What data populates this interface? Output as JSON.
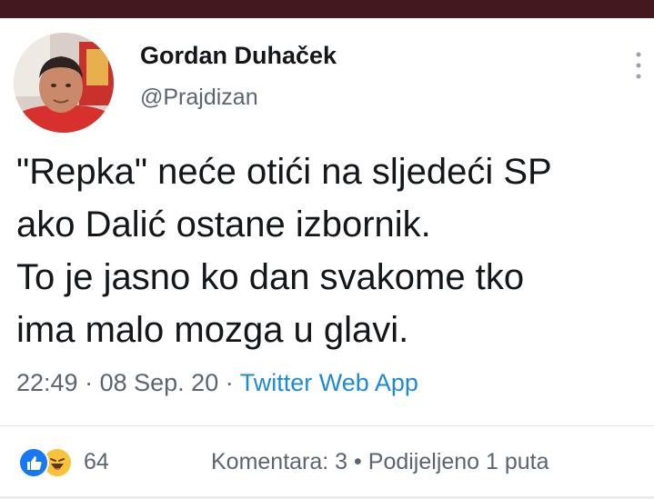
{
  "tweet": {
    "author_name": "Gordan Duhaček",
    "handle": "@Prajdizan",
    "text_lines": [
      "\"Repka\" neće otići na sljedeći SP",
      "ako Dalić ostane izbornik.",
      "To je jasno ko dan svakome tko",
      "ima malo mozga u glavi."
    ],
    "time": "22:49",
    "separator": "·",
    "date": "08 Sep. 20",
    "source": "Twitter Web App"
  },
  "post_footer": {
    "reaction_icons": [
      "like-icon",
      "haha-icon"
    ],
    "reaction_count": "64",
    "comments": "Komentara: 3",
    "dot": "•",
    "shares": "Podijeljeno 1 puta"
  },
  "colors": {
    "top_bar": "#43191e",
    "link_blue": "#1d8ad8",
    "like_blue": "#1877f2",
    "haha_yellow": "#f7c33a"
  }
}
